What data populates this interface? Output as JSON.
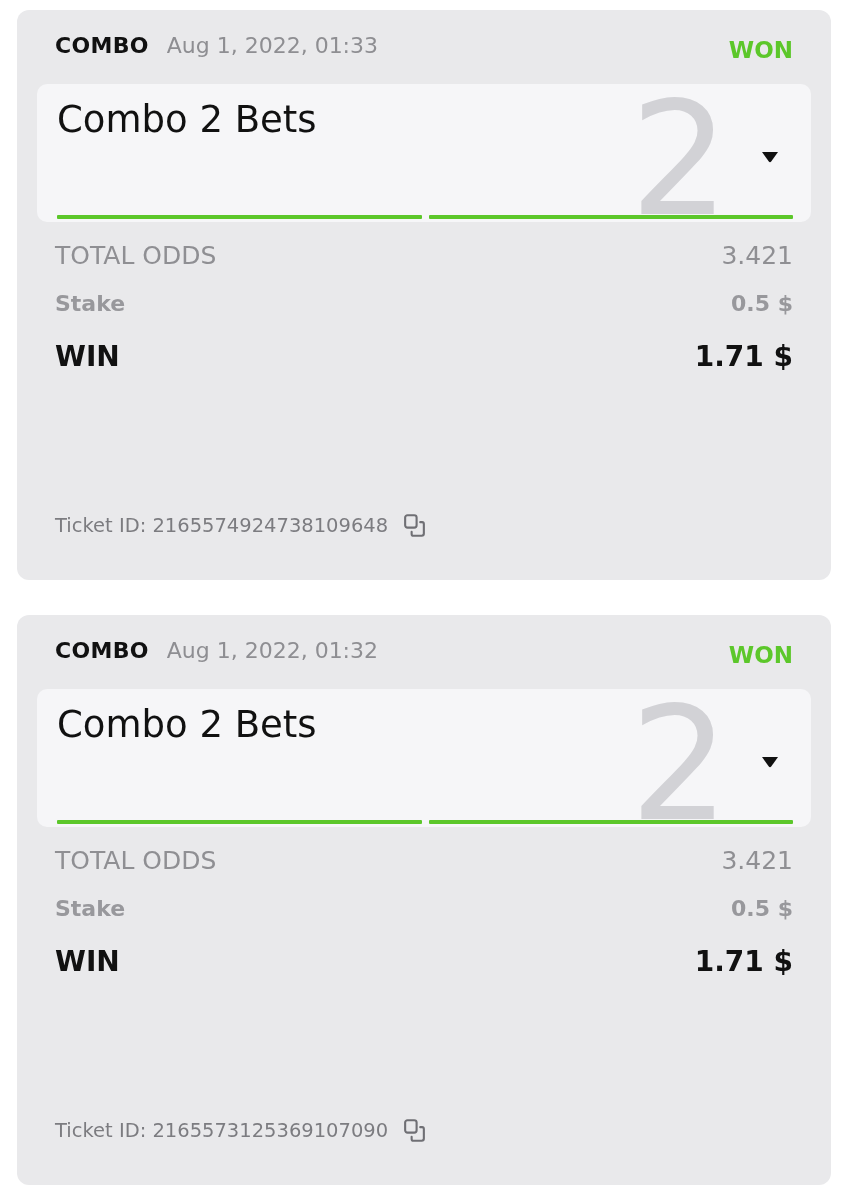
{
  "tickets": [
    {
      "type": "COMBO",
      "date": "Aug 1, 2022, 01:33",
      "status": {
        "label": "WON",
        "kind": "won"
      },
      "title": "Combo 2 Bets",
      "leg_count": "2",
      "expanded": false,
      "legs": [
        {
          "won": true
        },
        {
          "won": true
        }
      ],
      "rows": [
        {
          "kind": "odds",
          "label": "TOTAL ODDS",
          "value": "3.421"
        },
        {
          "kind": "stake",
          "label": "Stake",
          "value": "0.5 $"
        },
        {
          "kind": "win",
          "label": "WIN",
          "value": "1.71 $"
        }
      ],
      "ticket_id": "Ticket ID: 2165574924738109648"
    },
    {
      "type": "COMBO",
      "date": "Aug 1, 2022, 01:32",
      "status": {
        "label": "WON",
        "kind": "won"
      },
      "title": "Combo 2 Bets",
      "leg_count": "2",
      "expanded": false,
      "legs": [
        {
          "won": true
        },
        {
          "won": true
        }
      ],
      "rows": [
        {
          "kind": "odds",
          "label": "TOTAL ODDS",
          "value": "3.421"
        },
        {
          "kind": "stake",
          "label": "Stake",
          "value": "0.5 $"
        },
        {
          "kind": "win",
          "label": "WIN",
          "value": "1.71 $"
        }
      ],
      "ticket_id": "Ticket ID: 2165573125369107090"
    }
  ]
}
